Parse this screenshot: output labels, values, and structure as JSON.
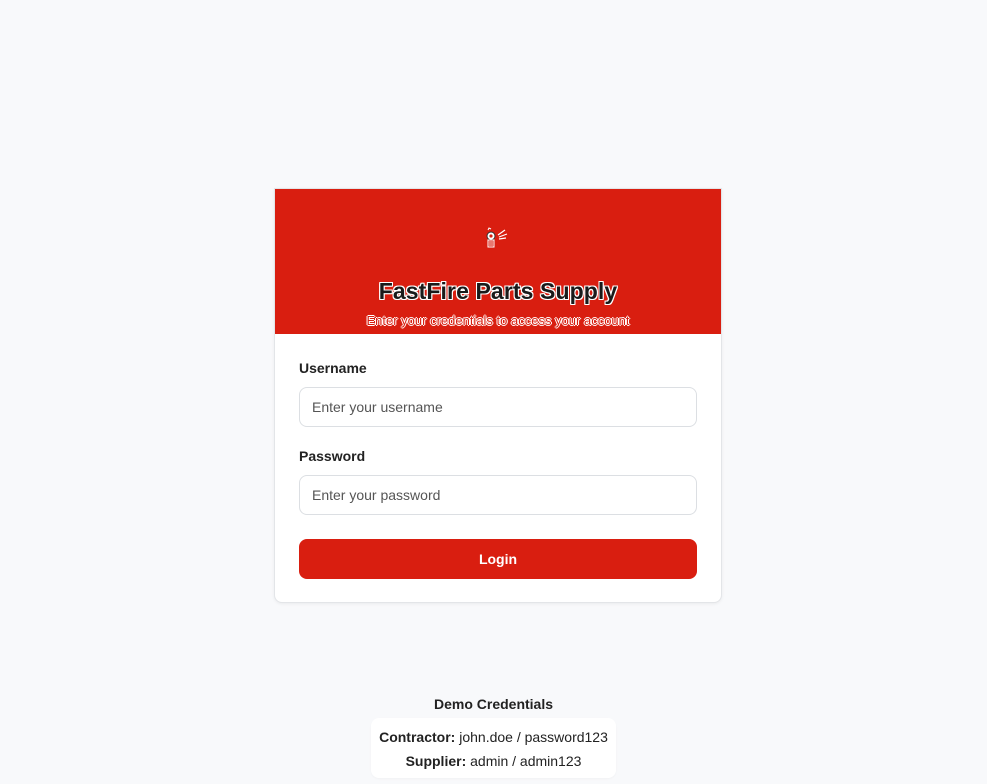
{
  "brand": {
    "title": "FastFire Parts Supply",
    "subtitle": "Enter your credentials to access your account",
    "logo_icon": "fire-hydrant-spray-icon",
    "accent_color": "#d91e10"
  },
  "form": {
    "username_label": "Username",
    "username_placeholder": "Enter your username",
    "username_value": "",
    "password_label": "Password",
    "password_placeholder": "Enter your password",
    "password_value": "",
    "login_label": "Login"
  },
  "demo": {
    "title": "Demo Credentials",
    "contractor_label": "Contractor:",
    "contractor_value": "john.doe / password123",
    "supplier_label": "Supplier:",
    "supplier_value": "admin / admin123"
  }
}
